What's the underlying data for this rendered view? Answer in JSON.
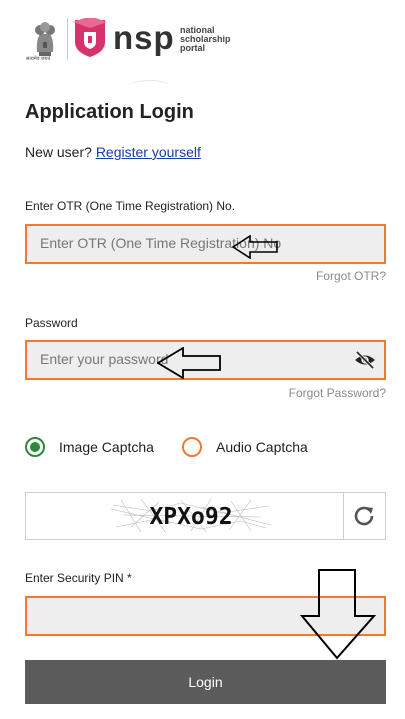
{
  "header": {
    "emblem_text": "सत्यमेव जयते",
    "brand": "nsp",
    "brand_sub_1": "national",
    "brand_sub_2": "scholarship",
    "brand_sub_3": "portal"
  },
  "page": {
    "title": "Application Login",
    "new_user_text": "New user?",
    "register_link": "Register yourself"
  },
  "otr": {
    "label": "Enter OTR (One Time Registration) No.",
    "placeholder": "Enter OTR (One Time Registration) No",
    "forgot": "Forgot OTR?"
  },
  "password": {
    "label": "Password",
    "placeholder": "Enter your password",
    "forgot": "Forgot Password?"
  },
  "captcha_options": {
    "image": "Image Captcha",
    "audio": "Audio Captcha",
    "selected": "Image Captcha"
  },
  "captcha": {
    "text": "XPXo92"
  },
  "pin": {
    "label": "Enter Security PIN *",
    "value": ""
  },
  "login_button": "Login",
  "colors": {
    "accent": "#f07a2a",
    "selected": "#2a8a3a",
    "link": "#1a3ba8",
    "button": "#5b5b5b",
    "brand": "#d6336c"
  },
  "icons": [
    "national-emblem-icon",
    "nsp-shield-icon",
    "eye-slash-icon",
    "refresh-icon",
    "arrow-left-icon",
    "arrow-down-icon"
  ]
}
